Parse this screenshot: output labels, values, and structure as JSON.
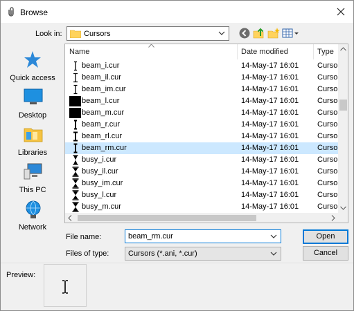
{
  "window": {
    "title": "Browse"
  },
  "lookin": {
    "label": "Look in:",
    "value": "Cursors"
  },
  "places": [
    {
      "label": "Quick access",
      "icon": "star-icon"
    },
    {
      "label": "Desktop",
      "icon": "desktop-icon"
    },
    {
      "label": "Libraries",
      "icon": "libraries-icon"
    },
    {
      "label": "This PC",
      "icon": "computer-icon"
    },
    {
      "label": "Network",
      "icon": "network-icon"
    }
  ],
  "columns": {
    "name": "Name",
    "date": "Date modified",
    "type": "Type"
  },
  "files": [
    {
      "name": "beam_i.cur",
      "date": "14-May-17 16:01",
      "type": "Cursor",
      "icon": "ibeam"
    },
    {
      "name": "beam_il.cur",
      "date": "14-May-17 16:01",
      "type": "Cursor",
      "icon": "ibeam-large"
    },
    {
      "name": "beam_im.cur",
      "date": "14-May-17 16:01",
      "type": "Cursor",
      "icon": "ibeam-medium"
    },
    {
      "name": "beam_l.cur",
      "date": "14-May-17 16:01",
      "type": "Cursor",
      "icon": "black-block"
    },
    {
      "name": "beam_m.cur",
      "date": "14-May-17 16:01",
      "type": "Cursor",
      "icon": "black-block"
    },
    {
      "name": "beam_r.cur",
      "date": "14-May-17 16:01",
      "type": "Cursor",
      "icon": "ibeam-bold"
    },
    {
      "name": "beam_rl.cur",
      "date": "14-May-17 16:01",
      "type": "Cursor",
      "icon": "ibeam-bold-large"
    },
    {
      "name": "beam_rm.cur",
      "date": "14-May-17 16:01",
      "type": "Cursor",
      "icon": "ibeam-bold-medium"
    },
    {
      "name": "busy_i.cur",
      "date": "14-May-17 16:01",
      "type": "Cursor",
      "icon": "hourglass"
    },
    {
      "name": "busy_il.cur",
      "date": "14-May-17 16:01",
      "type": "Cursor",
      "icon": "hourglass-large"
    },
    {
      "name": "busy_im.cur",
      "date": "14-May-17 16:01",
      "type": "Cursor",
      "icon": "hourglass-medium"
    },
    {
      "name": "busy_l.cur",
      "date": "14-May-17 16:01",
      "type": "Cursor",
      "icon": "hourglass-large"
    },
    {
      "name": "busy_m.cur",
      "date": "14-May-17 16:01",
      "type": "Cursor",
      "icon": "hourglass-large"
    }
  ],
  "selected_file": "beam_rm.cur",
  "filename": {
    "label": "File name:",
    "value": "beam_rm.cur"
  },
  "filetype": {
    "label": "Files of type:",
    "value": "Cursors (*.ani, *.cur)"
  },
  "buttons": {
    "open": "Open",
    "cancel": "Cancel"
  },
  "preview": {
    "label": "Preview:"
  },
  "colors": {
    "accent": "#0078d7",
    "selection": "#cce8ff",
    "folder": "#ffd35c"
  }
}
